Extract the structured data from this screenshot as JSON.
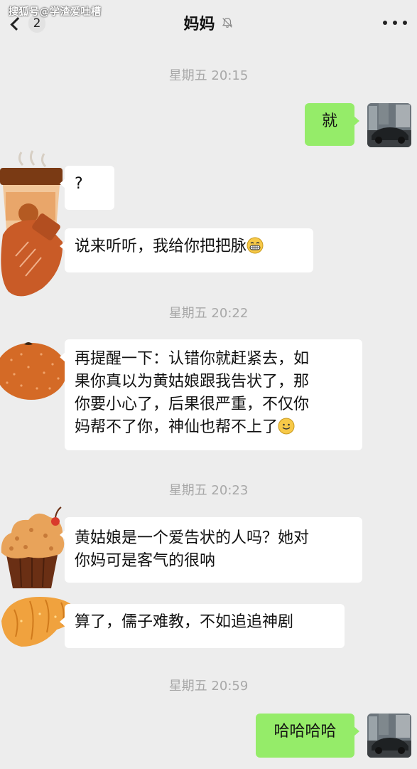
{
  "watermark": "搜狐号@学渣爱吐槽",
  "header": {
    "unread_count": "2",
    "title": "妈妈",
    "muted": true
  },
  "messages": [
    {
      "type": "time",
      "text": "星期五 20:15"
    },
    {
      "type": "msg",
      "side": "right",
      "lines": [
        "就"
      ]
    },
    {
      "type": "msg",
      "side": "left",
      "lines": [
        "?"
      ]
    },
    {
      "type": "msg",
      "side": "left",
      "lines": [
        "说来听听，我给你把把脉"
      ],
      "emoji": "grin"
    },
    {
      "type": "time",
      "text": "星期五 20:22"
    },
    {
      "type": "msg",
      "side": "left",
      "lines": [
        "再提醒一下：认错你就赶紧去，如",
        "果你真以为黄姑娘跟我告状了，那",
        "你要小心了，后果很严重，不仅你",
        "妈帮不了你，神仙也帮不上了"
      ],
      "emoji": "smile"
    },
    {
      "type": "time",
      "text": "星期五 20:23"
    },
    {
      "type": "msg",
      "side": "left",
      "lines": [
        "黄姑娘是一个爱告状的人吗？她对",
        "你妈可是客气的很呐"
      ]
    },
    {
      "type": "msg",
      "side": "left",
      "lines": [
        "算了，儒子难教，不如追追神剧"
      ]
    },
    {
      "type": "time",
      "text": "星期五 20:59"
    },
    {
      "type": "msg",
      "side": "right",
      "lines": [
        "哈哈哈哈"
      ]
    }
  ],
  "colors": {
    "background": "#ededed",
    "bubble_self": "#95ec69",
    "bubble_other": "#ffffff",
    "timestamp": "#a8a8a8"
  }
}
